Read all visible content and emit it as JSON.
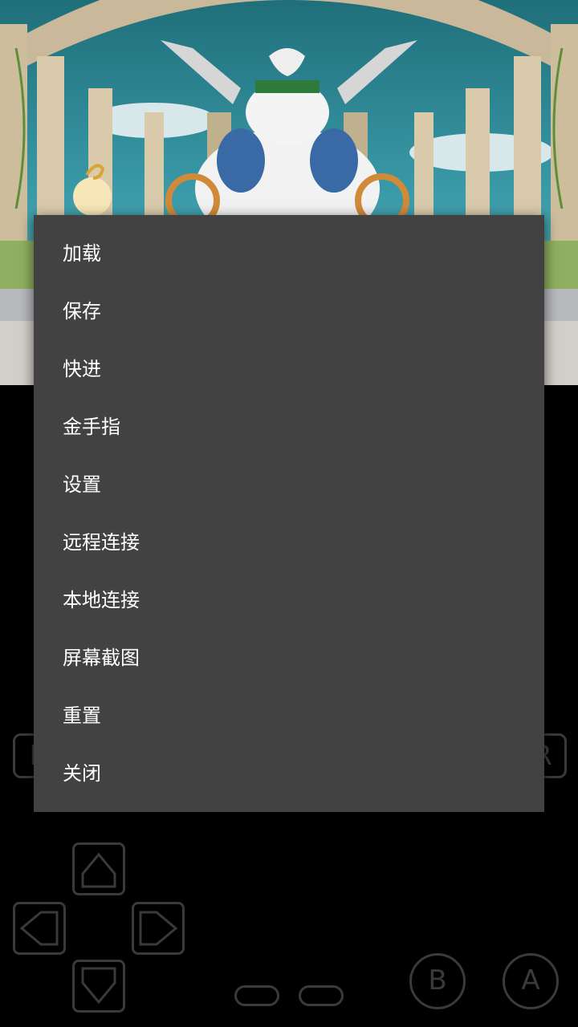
{
  "menu": {
    "items": [
      {
        "label": "加载"
      },
      {
        "label": "保存"
      },
      {
        "label": "快进"
      },
      {
        "label": "金手指"
      },
      {
        "label": "设置"
      },
      {
        "label": "远程连接"
      },
      {
        "label": "本地连接"
      },
      {
        "label": "屏幕截图"
      },
      {
        "label": "重置"
      },
      {
        "label": "关闭"
      }
    ]
  },
  "controls": {
    "l_label": "L",
    "r_label": "R",
    "b_label": "B",
    "a_label": "A"
  },
  "colors": {
    "menu_background": "#424242",
    "menu_text": "#ffffff",
    "control_outline": "#3a3a3a",
    "screen_background": "#000000"
  }
}
